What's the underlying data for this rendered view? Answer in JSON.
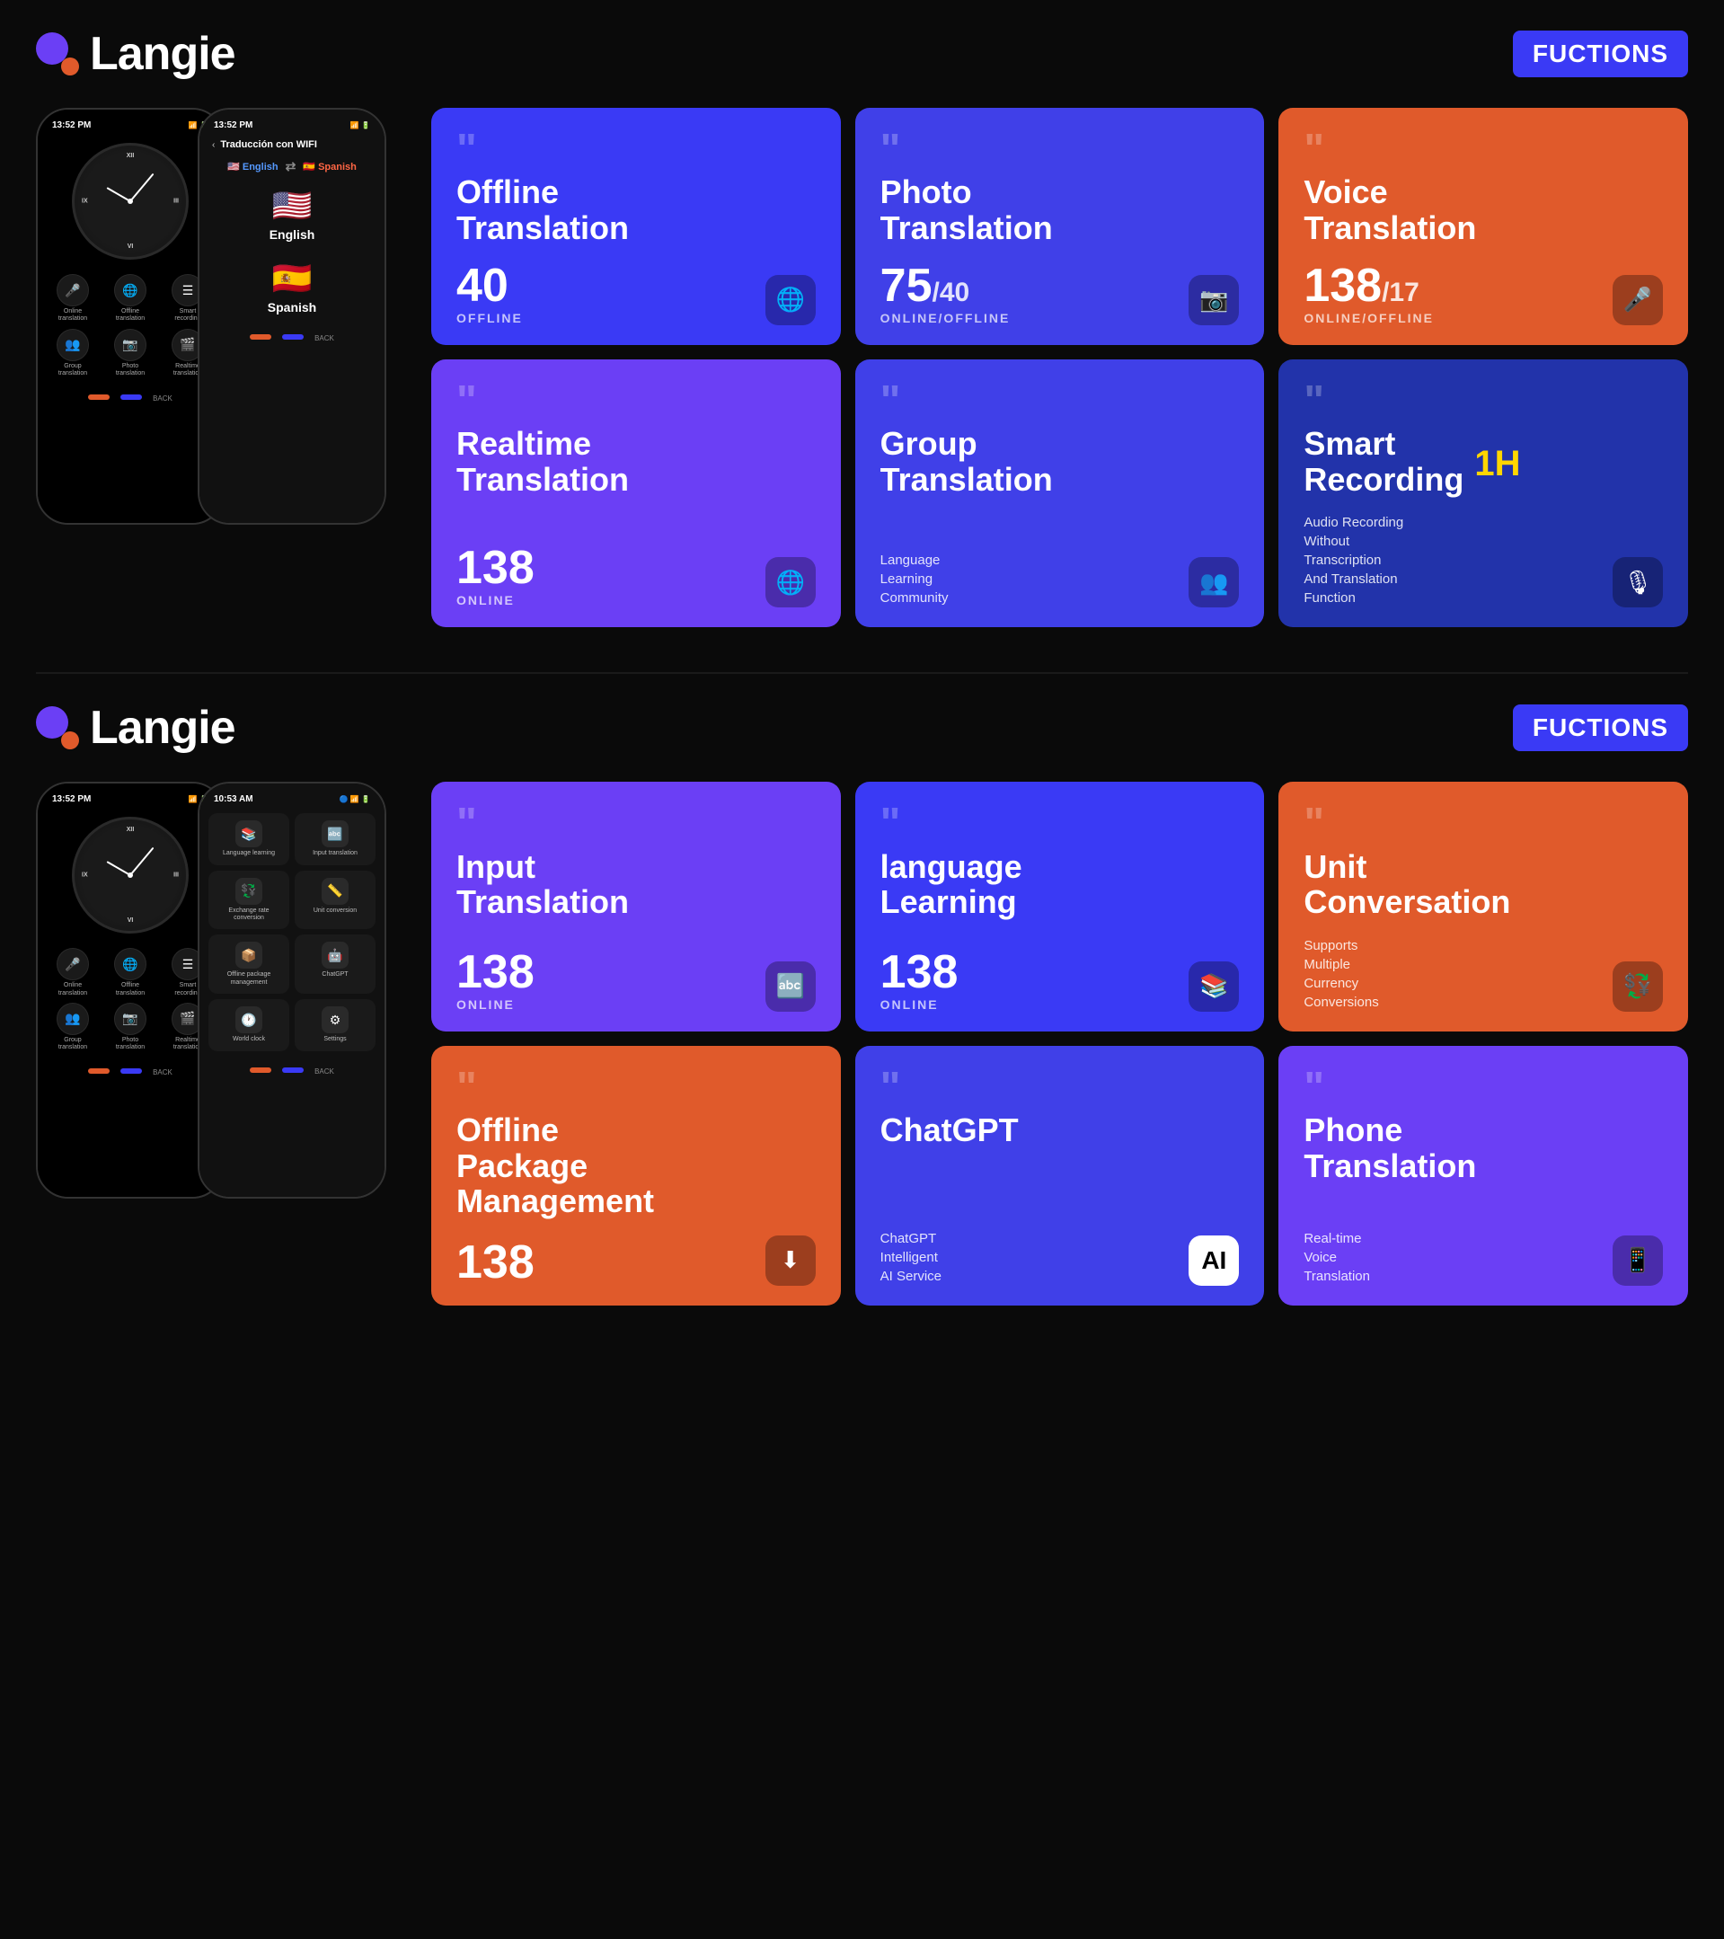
{
  "sections": [
    {
      "id": "section1",
      "logo": {
        "text": "Langie",
        "badge": "FUCTIONS"
      },
      "phone1": {
        "time": "13:52 PM",
        "icons": [
          "📶",
          "🔋"
        ],
        "clock_numbers": [
          "XII",
          "III",
          "VI",
          "IX"
        ],
        "bottom_icons": [
          {
            "icon": "🎤",
            "label": "Online\ntranslation"
          },
          {
            "icon": "🌐",
            "label": "Offline\ntranslation"
          },
          {
            "icon": "⋮",
            "label": "Smart\nrecording"
          },
          {
            "icon": "👥",
            "label": "Group\ntranslation"
          },
          {
            "icon": "📷",
            "label": "Photo\ntranslation"
          },
          {
            "icon": "🎬",
            "label": "Realtime\ntranslation"
          }
        ]
      },
      "phone2": {
        "time": "13:52 PM",
        "title": "Traducción con WIFI",
        "lang_from": "🇺🇸 English",
        "lang_to": "🇪🇸 Spanish",
        "flags": [
          {
            "emoji": "🇺🇸",
            "name": "English"
          },
          {
            "emoji": "🇪🇸",
            "name": "Spanish"
          }
        ]
      },
      "cards": [
        {
          "id": "offline-translation",
          "color": "fc-blue",
          "quote": "\"",
          "title": "Offline\nTranslation",
          "count": "40",
          "count_sub": "",
          "status": "OFFLINE",
          "icon": "🌐",
          "desc": ""
        },
        {
          "id": "photo-translation",
          "color": "fc-indigo",
          "quote": "\"",
          "title": "Photo\nTranslation",
          "count": "75",
          "count_sub": "/40",
          "status": "ONLINE/OFFLINE",
          "icon": "📷",
          "desc": ""
        },
        {
          "id": "voice-translation",
          "color": "fc-orange",
          "quote": "\"",
          "title": "Voice\nTranslation",
          "count": "138",
          "count_sub": "/17",
          "status": "ONLINE/OFFLINE",
          "icon": "🎤",
          "desc": ""
        },
        {
          "id": "realtime-translation",
          "color": "fc-purple",
          "quote": "\"",
          "title": "Realtime\nTranslation",
          "count": "138",
          "count_sub": "",
          "status": "ONLINE",
          "icon": "🌐",
          "desc": ""
        },
        {
          "id": "group-translation",
          "color": "fc-indigo",
          "quote": "\"",
          "title": "Group\nTranslation",
          "count": "",
          "count_sub": "",
          "status": "",
          "icon": "👥",
          "desc": "Language\nLearning\nCommunity"
        },
        {
          "id": "smart-recording",
          "color": "fc-dark-blue",
          "quote": "\"",
          "title": "Smart\nRecording",
          "count": "",
          "count_sub": "",
          "status": "",
          "icon": "🎙",
          "badge": "1H",
          "desc": "Audio Recording\nWithout\nTranscription\nAnd Translation\nFunction"
        }
      ]
    },
    {
      "id": "section2",
      "logo": {
        "text": "Langie",
        "badge": "FUCTIONS"
      },
      "phone1": {
        "time": "13:52 PM",
        "icons": [
          "📶",
          "🔋"
        ]
      },
      "phone2": {
        "time": "10:53 AM",
        "menu_items": [
          {
            "icon": "📚",
            "label": "Language learning"
          },
          {
            "icon": "🔤",
            "label": "Input translation"
          },
          {
            "icon": "💱",
            "label": "Exchange rate\nconversion"
          },
          {
            "icon": "📏",
            "label": "Unit conversion"
          },
          {
            "icon": "📦",
            "label": "Offline package\nmanagement"
          },
          {
            "icon": "🤖",
            "label": "ChatGPT"
          },
          {
            "icon": "🕐",
            "label": "World clock"
          },
          {
            "icon": "⚙",
            "label": "Settings"
          }
        ]
      },
      "cards": [
        {
          "id": "input-translation",
          "color": "fc-purple",
          "quote": "\"",
          "title": "Input\nTranslation",
          "count": "138",
          "count_sub": "",
          "status": "ONLINE",
          "icon": "🔤",
          "desc": ""
        },
        {
          "id": "language-learning",
          "color": "fc-blue",
          "quote": "\"",
          "title": "language\nLearning",
          "count": "138",
          "count_sub": "",
          "status": "ONLINE",
          "icon": "📚",
          "desc": ""
        },
        {
          "id": "unit-conversation",
          "color": "fc-orange",
          "quote": "\"",
          "title": "Unit\nConversation",
          "count": "",
          "count_sub": "",
          "status": "",
          "icon": "💱",
          "desc": "Supports\nMultiple\nCurrency\nConversions"
        },
        {
          "id": "offline-package",
          "color": "fc-orange",
          "quote": "\"",
          "title": "Offline\nPackage\nManagement",
          "count": "138",
          "count_sub": "",
          "status": "",
          "icon": "⬇",
          "desc": ""
        },
        {
          "id": "chatgpt",
          "color": "fc-indigo",
          "quote": "\"",
          "title": "ChatGPT",
          "count": "",
          "count_sub": "",
          "status": "",
          "icon": "🤖",
          "desc": "ChatGPT\nIntelligent\nAI Service"
        },
        {
          "id": "phone-translation",
          "color": "fc-purple",
          "quote": "\"",
          "title": "Phone\nTranslation",
          "count": "",
          "count_sub": "",
          "status": "",
          "icon": "📱",
          "desc": "Real-time\nVoice\nTranslation"
        }
      ]
    }
  ]
}
